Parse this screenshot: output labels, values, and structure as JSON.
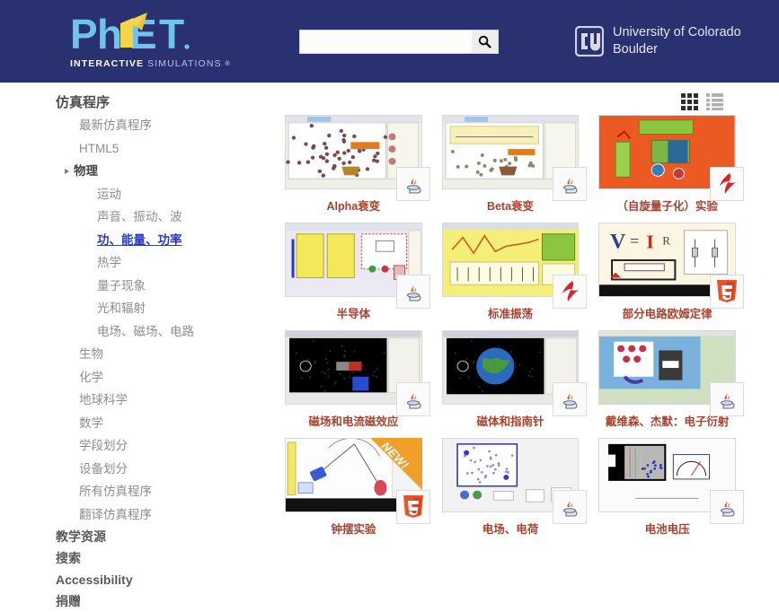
{
  "header": {
    "logo": {
      "phet": "PhET",
      "interactive": "INTERACTIVE",
      "simulations": "SIMULATIONS",
      "registered": "®"
    },
    "search": {
      "value": "",
      "placeholder": "",
      "icon": "search-icon"
    },
    "university": {
      "line1": "University of Colorado",
      "line2": "Boulder",
      "monogram": "CU"
    },
    "colors": {
      "header_bg": "#2a3170",
      "logo_blue": "#6fc4ee",
      "logo_yellow": "#f5d547"
    }
  },
  "sidebar": {
    "title": "仿真程序",
    "items": [
      {
        "label": "最新仿真程序",
        "level": 1
      },
      {
        "label": "HTML5",
        "level": 1
      },
      {
        "label": "物理",
        "level": 1,
        "expanded": true,
        "bold": true
      },
      {
        "label": "运动",
        "level": 2
      },
      {
        "label": "声音、振动、波",
        "level": 2
      },
      {
        "label": "功、能量、功率",
        "level": 2,
        "selected": true
      },
      {
        "label": "热学",
        "level": 2
      },
      {
        "label": "量子现象",
        "level": 2
      },
      {
        "label": "光和辐射",
        "level": 2
      },
      {
        "label": "电场、磁场、电路",
        "level": 2
      },
      {
        "label": "生物",
        "level": 1
      },
      {
        "label": "化学",
        "level": 1
      },
      {
        "label": "地球科学",
        "level": 1
      },
      {
        "label": "数学",
        "level": 1
      },
      {
        "label": "学段划分",
        "level": 1
      },
      {
        "label": "设备划分",
        "level": 1
      },
      {
        "label": "所有仿真程序",
        "level": 1
      },
      {
        "label": "翻译仿真程序",
        "level": 1
      }
    ],
    "footer_items": [
      {
        "label": "教学资源"
      },
      {
        "label": "搜索"
      },
      {
        "label": "Accessibility"
      },
      {
        "label": "捐赠"
      }
    ]
  },
  "main": {
    "view_toggles": [
      {
        "name": "grid-view",
        "active": true
      },
      {
        "name": "list-view",
        "active": false
      }
    ],
    "simulations": [
      {
        "title": "Alpha衰变",
        "badge": "java",
        "style": "alpha"
      },
      {
        "title": "Beta衰变",
        "badge": "java",
        "style": "beta"
      },
      {
        "title": "（自旋量子化）实验",
        "badge": "flash",
        "style": "stern"
      },
      {
        "title": "半导体",
        "badge": "java",
        "style": "semiconductor"
      },
      {
        "title": "标准振荡",
        "badge": "flash",
        "style": "normal-modes"
      },
      {
        "title": "部分电路欧姆定律",
        "badge": "html5",
        "style": "ohms"
      },
      {
        "title": "磁场和电流磁效应",
        "badge": "java",
        "style": "magnet-field"
      },
      {
        "title": "磁体和指南针",
        "badge": "java",
        "style": "magnet-compass"
      },
      {
        "title": "戴维森、杰默：电子衍射",
        "badge": "java",
        "style": "davisson"
      },
      {
        "title": "钟摆实验",
        "badge": "html5",
        "style": "pendulum",
        "ribbon": "NEW!"
      },
      {
        "title": "电场、电荷",
        "badge": "java",
        "style": "efield"
      },
      {
        "title": "电池电压",
        "badge": "java",
        "style": "battery"
      }
    ]
  }
}
